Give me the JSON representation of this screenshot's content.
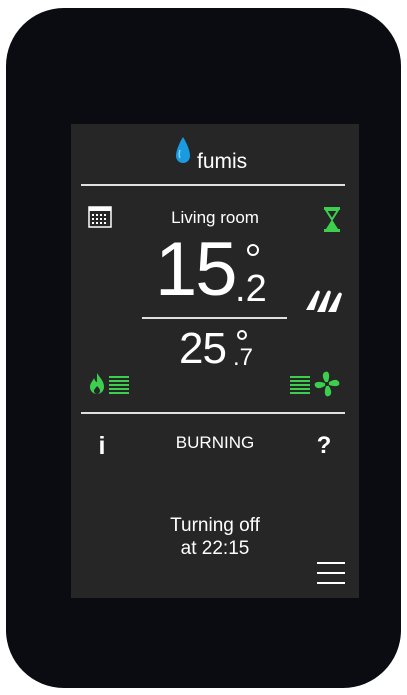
{
  "header": {
    "brand": "fumis",
    "drop_icon": "water-drop-icon"
  },
  "room": {
    "name": "Living room"
  },
  "temperatures": {
    "current_int": "15",
    "current_dec": "2",
    "setpoint_int": "25",
    "setpoint_dec": "7"
  },
  "status": {
    "label": "BURNING"
  },
  "buttons": {
    "info": "i",
    "help": "?"
  },
  "message": {
    "line1": "Turning off",
    "line2": "at 22:15"
  },
  "colors": {
    "accent": "#3ccf4e",
    "brand_blue": "#1a9be0",
    "screen": "#262626"
  },
  "icons": [
    "calendar-icon",
    "hourglass-icon",
    "leaf-icon",
    "flame-icon",
    "fan-icon",
    "menu-icon"
  ]
}
